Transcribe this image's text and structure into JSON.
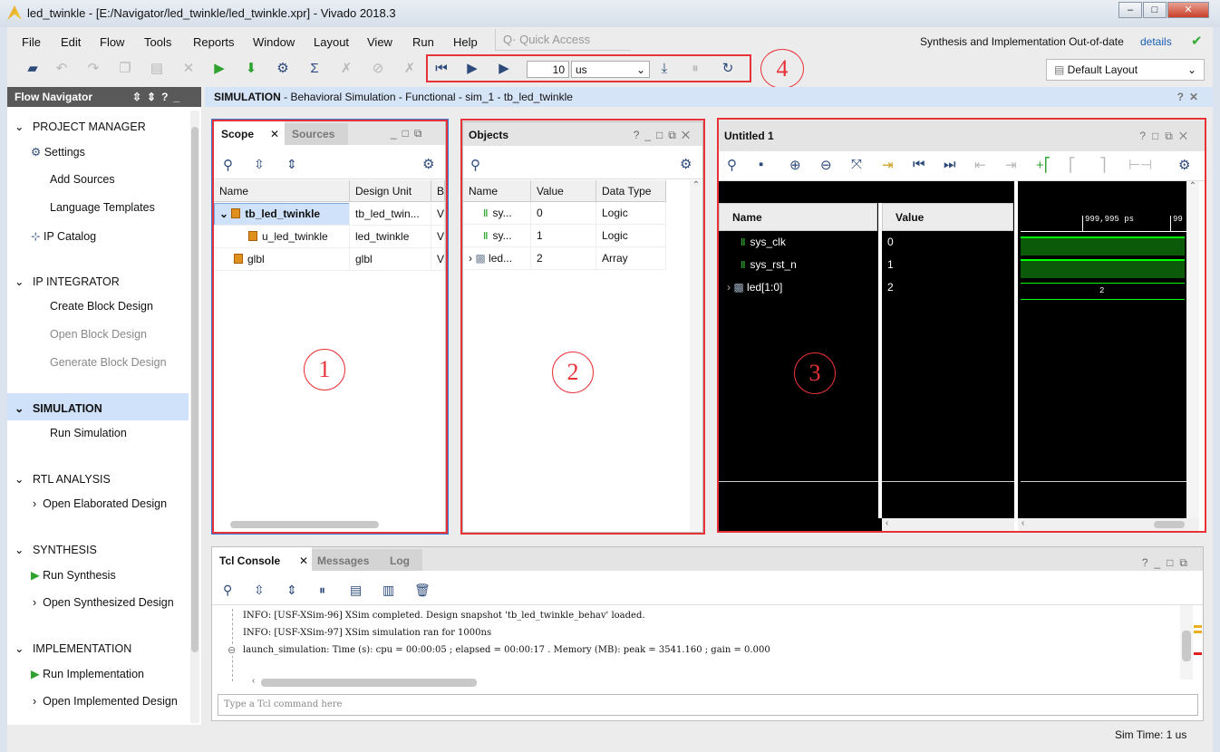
{
  "window": {
    "title": "led_twinkle - [E:/Navigator/led_twinkle/led_twinkle.xpr] - Vivado 2018.3",
    "controls": [
      "minimize",
      "maximize",
      "close"
    ]
  },
  "menu": [
    "File",
    "Edit",
    "Flow",
    "Tools",
    "Reports",
    "Window",
    "Layout",
    "View",
    "Run",
    "Help"
  ],
  "quick_access": {
    "placeholder": "Quick Access"
  },
  "status_right": {
    "text": "Synthesis and Implementation Out-of-date",
    "link": "details"
  },
  "toolbar": {
    "run_time_value": "10",
    "run_time_unit": "us",
    "layout": "Default Layout"
  },
  "flow_navigator": {
    "title": "Flow Navigator",
    "sections": [
      {
        "label": "PROJECT MANAGER",
        "items": [
          "Settings",
          "Add Sources",
          "Language Templates",
          "IP Catalog"
        ]
      },
      {
        "label": "IP INTEGRATOR",
        "items": [
          "Create Block Design",
          "Open Block Design",
          "Generate Block Design"
        ]
      },
      {
        "label": "SIMULATION",
        "items": [
          "Run Simulation"
        ]
      },
      {
        "label": "RTL ANALYSIS",
        "items": [
          "Open Elaborated Design"
        ]
      },
      {
        "label": "SYNTHESIS",
        "items": [
          "Run Synthesis",
          "Open Synthesized Design"
        ]
      },
      {
        "label": "IMPLEMENTATION",
        "items": [
          "Run Implementation",
          "Open Implemented Design"
        ]
      }
    ]
  },
  "main_header": {
    "bold": "SIMULATION",
    "rest": " - Behavioral Simulation - Functional - sim_1 - tb_led_twinkle"
  },
  "scope": {
    "tabs": [
      "Scope",
      "Sources"
    ],
    "columns": [
      "Name",
      "Design Unit",
      "B"
    ],
    "rows": [
      {
        "name": "tb_led_twinkle",
        "unit": "tb_led_twin...",
        "b": "V"
      },
      {
        "name": "u_led_twinkle",
        "unit": "led_twinkle",
        "b": "V"
      },
      {
        "name": "glbl",
        "unit": "glbl",
        "b": "V"
      }
    ]
  },
  "objects": {
    "title": "Objects",
    "columns": [
      "Name",
      "Value",
      "Data Type"
    ],
    "rows": [
      {
        "name": "sy...",
        "value": "0",
        "type": "Logic"
      },
      {
        "name": "sy...",
        "value": "1",
        "type": "Logic"
      },
      {
        "name": "led...",
        "value": "2",
        "type": "Array"
      }
    ]
  },
  "wave": {
    "title": "Untitled 1",
    "columns": [
      "Name",
      "Value"
    ],
    "cursor_time": "999,995 ps",
    "cursor2": "99",
    "signals": [
      {
        "name": "sys_clk",
        "value": "0"
      },
      {
        "name": "sys_rst_n",
        "value": "1"
      },
      {
        "name": "led[1:0]",
        "value": "2",
        "bus": "2"
      }
    ]
  },
  "console": {
    "tabs": [
      "Tcl Console",
      "Messages",
      "Log"
    ],
    "lines": [
      "INFO: [USF-XSim-96] XSim completed. Design snapshot 'tb_led_twinkle_behav' loaded.",
      "INFO: [USF-XSim-97] XSim simulation ran for 1000ns",
      "launch_simulation: Time (s): cpu = 00:00:05 ; elapsed = 00:00:17 . Memory (MB): peak = 3541.160 ; gain = 0.000"
    ],
    "input_placeholder": "Type a Tcl command here"
  },
  "statusbar": {
    "sim_time": "Sim Time: 1 us"
  },
  "annotations": [
    "1",
    "2",
    "3",
    "4"
  ],
  "colors": {
    "annotation": "#e8323a",
    "wave_green": "#00ff00",
    "selected_row": "#cfe2fa",
    "header_blue": "#d6e4f7"
  }
}
